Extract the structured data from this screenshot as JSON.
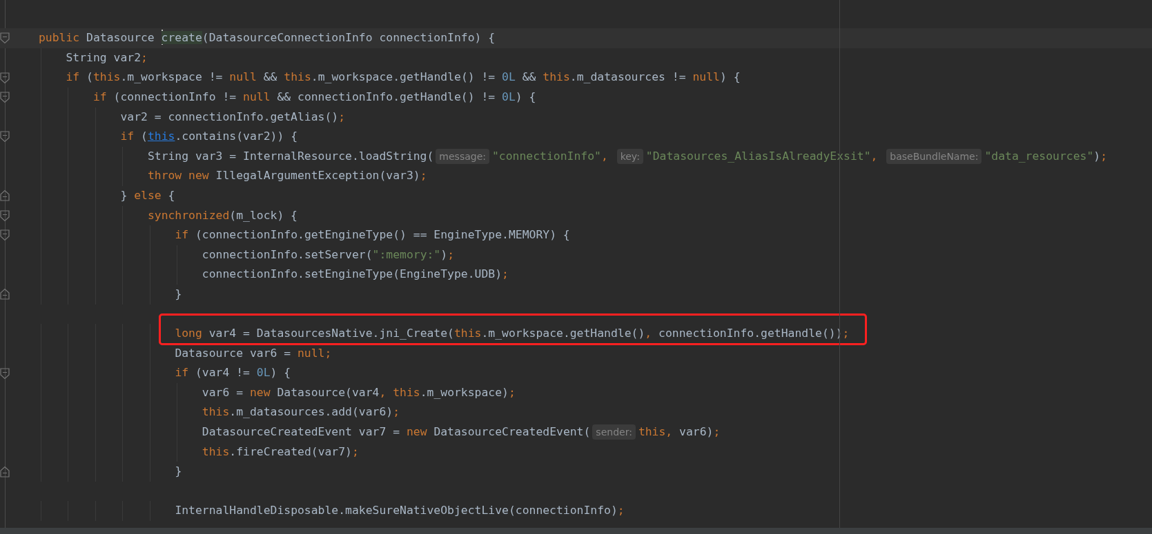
{
  "editor": {
    "lines": [
      {
        "kind": "code",
        "current": true,
        "fold_start": true,
        "tokens": [
          {
            "text": "public",
            "kind": "kw"
          },
          {
            "text": " Datasource ",
            "kind": "plain"
          },
          {
            "text": "create",
            "kind": "match",
            "caret_before": true
          },
          {
            "text": "(DatasourceConnectionInfo connectionInfo) {",
            "kind": "plain"
          }
        ],
        "children": [
          {
            "kind": "code",
            "tokens": [
              {
                "text": "String var2",
                "kind": "plain"
              },
              {
                "text": ";",
                "kind": "kw"
              }
            ]
          },
          {
            "kind": "code",
            "fold_start": true,
            "tokens": [
              {
                "text": "if",
                "kind": "kw"
              },
              {
                "text": " (",
                "kind": "plain"
              },
              {
                "text": "this",
                "kind": "kw"
              },
              {
                "text": ".m_workspace != ",
                "kind": "plain"
              },
              {
                "text": "null",
                "kind": "kw"
              },
              {
                "text": " && ",
                "kind": "plain"
              },
              {
                "text": "this",
                "kind": "kw"
              },
              {
                "text": ".m_workspace.getHandle() != ",
                "kind": "plain"
              },
              {
                "text": "0L",
                "kind": "num"
              },
              {
                "text": " && ",
                "kind": "plain"
              },
              {
                "text": "this",
                "kind": "kw"
              },
              {
                "text": ".m_datasources != ",
                "kind": "plain"
              },
              {
                "text": "null",
                "kind": "kw"
              },
              {
                "text": ") {",
                "kind": "plain"
              }
            ],
            "children": [
              {
                "kind": "code",
                "fold_start": true,
                "tokens": [
                  {
                    "text": "if",
                    "kind": "kw"
                  },
                  {
                    "text": " (connectionInfo != ",
                    "kind": "plain"
                  },
                  {
                    "text": "null",
                    "kind": "kw"
                  },
                  {
                    "text": " && connectionInfo.getHandle() != ",
                    "kind": "plain"
                  },
                  {
                    "text": "0L",
                    "kind": "num"
                  },
                  {
                    "text": ") {",
                    "kind": "plain"
                  }
                ],
                "children": [
                  {
                    "kind": "code",
                    "tokens": [
                      {
                        "text": "var2 = connectionInfo.getAlias()",
                        "kind": "plain"
                      },
                      {
                        "text": ";",
                        "kind": "kw"
                      }
                    ]
                  },
                  {
                    "kind": "code",
                    "fold_start": true,
                    "tokens": [
                      {
                        "text": "if",
                        "kind": "kw"
                      },
                      {
                        "text": " (",
                        "kind": "plain"
                      },
                      {
                        "text": "this",
                        "kind": "link"
                      },
                      {
                        "text": ".contains(var2)) {",
                        "kind": "plain"
                      }
                    ],
                    "children": [
                      {
                        "kind": "code",
                        "tokens": [
                          {
                            "text": "String var3 = InternalResource.loadString(",
                            "kind": "plain"
                          },
                          {
                            "text": "message:",
                            "kind": "hint"
                          },
                          {
                            "text": "\"connectionInfo\"",
                            "kind": "str"
                          },
                          {
                            "text": ", ",
                            "kind": "kw"
                          },
                          {
                            "text": "key:",
                            "kind": "hint"
                          },
                          {
                            "text": "\"Datasources_AliasIsAlreadyExsit\"",
                            "kind": "str"
                          },
                          {
                            "text": ", ",
                            "kind": "kw"
                          },
                          {
                            "text": "baseBundleName:",
                            "kind": "hint"
                          },
                          {
                            "text": "\"data_resources\"",
                            "kind": "str"
                          },
                          {
                            "text": ")",
                            "kind": "plain"
                          },
                          {
                            "text": ";",
                            "kind": "kw"
                          }
                        ]
                      },
                      {
                        "kind": "code",
                        "tokens": [
                          {
                            "text": "throw new",
                            "kind": "kw"
                          },
                          {
                            "text": " IllegalArgumentException(var3)",
                            "kind": "plain"
                          },
                          {
                            "text": ";",
                            "kind": "kw"
                          }
                        ]
                      }
                    ]
                  },
                  {
                    "kind": "code",
                    "fold_end": true,
                    "tokens": [
                      {
                        "text": "} ",
                        "kind": "plain"
                      },
                      {
                        "text": "else",
                        "kind": "kw"
                      },
                      {
                        "text": " {",
                        "kind": "plain"
                      }
                    ],
                    "children": [
                      {
                        "kind": "code",
                        "fold_start": true,
                        "tokens": [
                          {
                            "text": "synchronized",
                            "kind": "kw"
                          },
                          {
                            "text": "(m_lock) {",
                            "kind": "plain"
                          }
                        ],
                        "children": [
                          {
                            "kind": "code",
                            "fold_start": true,
                            "tokens": [
                              {
                                "text": "if",
                                "kind": "kw"
                              },
                              {
                                "text": " (connectionInfo.getEngineType() == EngineType.MEMORY) {",
                                "kind": "plain"
                              }
                            ],
                            "children": [
                              {
                                "kind": "code",
                                "tokens": [
                                  {
                                    "text": "connectionInfo.setServer(",
                                    "kind": "plain"
                                  },
                                  {
                                    "text": "\":memory:\"",
                                    "kind": "str"
                                  },
                                  {
                                    "text": ")",
                                    "kind": "plain"
                                  },
                                  {
                                    "text": ";",
                                    "kind": "kw"
                                  }
                                ]
                              },
                              {
                                "kind": "code",
                                "tokens": [
                                  {
                                    "text": "connectionInfo.setEngineType(EngineType.UDB)",
                                    "kind": "plain"
                                  },
                                  {
                                    "text": ";",
                                    "kind": "kw"
                                  }
                                ]
                              }
                            ]
                          },
                          {
                            "kind": "code",
                            "fold_end": true,
                            "tokens": [
                              {
                                "text": "}",
                                "kind": "plain"
                              }
                            ]
                          },
                          {
                            "kind": "blank"
                          },
                          {
                            "kind": "code",
                            "boxed": true,
                            "tokens": [
                              {
                                "text": "long",
                                "kind": "kw"
                              },
                              {
                                "text": " var4 = DatasourcesNative.jni_Create(",
                                "kind": "plain"
                              },
                              {
                                "text": "this",
                                "kind": "kw"
                              },
                              {
                                "text": ".m_workspace.getHandle()",
                                "kind": "plain"
                              },
                              {
                                "text": ", ",
                                "kind": "kw"
                              },
                              {
                                "text": "connectionInfo.getHandle())",
                                "kind": "plain"
                              },
                              {
                                "text": ";",
                                "kind": "kw"
                              }
                            ]
                          },
                          {
                            "kind": "code",
                            "tokens": [
                              {
                                "text": "Datasource var6 = ",
                                "kind": "plain"
                              },
                              {
                                "text": "null;",
                                "kind": "kw"
                              }
                            ]
                          },
                          {
                            "kind": "code",
                            "fold_start": true,
                            "tokens": [
                              {
                                "text": "if",
                                "kind": "kw"
                              },
                              {
                                "text": " (var4 != ",
                                "kind": "plain"
                              },
                              {
                                "text": "0L",
                                "kind": "num"
                              },
                              {
                                "text": ") {",
                                "kind": "plain"
                              }
                            ],
                            "children": [
                              {
                                "kind": "code",
                                "tokens": [
                                  {
                                    "text": "var6 = ",
                                    "kind": "plain"
                                  },
                                  {
                                    "text": "new",
                                    "kind": "kw"
                                  },
                                  {
                                    "text": " Datasource(var4",
                                    "kind": "plain"
                                  },
                                  {
                                    "text": ", this",
                                    "kind": "kw"
                                  },
                                  {
                                    "text": ".m_workspace)",
                                    "kind": "plain"
                                  },
                                  {
                                    "text": ";",
                                    "kind": "kw"
                                  }
                                ]
                              },
                              {
                                "kind": "code",
                                "tokens": [
                                  {
                                    "text": "this",
                                    "kind": "kw"
                                  },
                                  {
                                    "text": ".m_datasources.add(var6)",
                                    "kind": "plain"
                                  },
                                  {
                                    "text": ";",
                                    "kind": "kw"
                                  }
                                ]
                              },
                              {
                                "kind": "code",
                                "tokens": [
                                  {
                                    "text": "DatasourceCreatedEvent var7 = ",
                                    "kind": "plain"
                                  },
                                  {
                                    "text": "new",
                                    "kind": "kw"
                                  },
                                  {
                                    "text": " DatasourceCreatedEvent(",
                                    "kind": "plain"
                                  },
                                  {
                                    "text": "sender:",
                                    "kind": "hint"
                                  },
                                  {
                                    "text": "this, ",
                                    "kind": "kw"
                                  },
                                  {
                                    "text": "var6)",
                                    "kind": "plain"
                                  },
                                  {
                                    "text": ";",
                                    "kind": "kw"
                                  }
                                ]
                              },
                              {
                                "kind": "code",
                                "tokens": [
                                  {
                                    "text": "this",
                                    "kind": "kw"
                                  },
                                  {
                                    "text": ".fireCreated(var7)",
                                    "kind": "plain"
                                  },
                                  {
                                    "text": ";",
                                    "kind": "kw"
                                  }
                                ]
                              }
                            ]
                          },
                          {
                            "kind": "code",
                            "fold_end": true,
                            "tokens": [
                              {
                                "text": "}",
                                "kind": "plain"
                              }
                            ]
                          },
                          {
                            "kind": "blank"
                          },
                          {
                            "kind": "code",
                            "tokens": [
                              {
                                "text": "InternalHandleDisposable.makeSureNativeObjectLive(connectionInfo)",
                                "kind": "plain"
                              },
                              {
                                "text": ";",
                                "kind": "kw"
                              }
                            ]
                          }
                        ]
                      }
                    ]
                  }
                ]
              }
            ]
          }
        ]
      }
    ]
  }
}
